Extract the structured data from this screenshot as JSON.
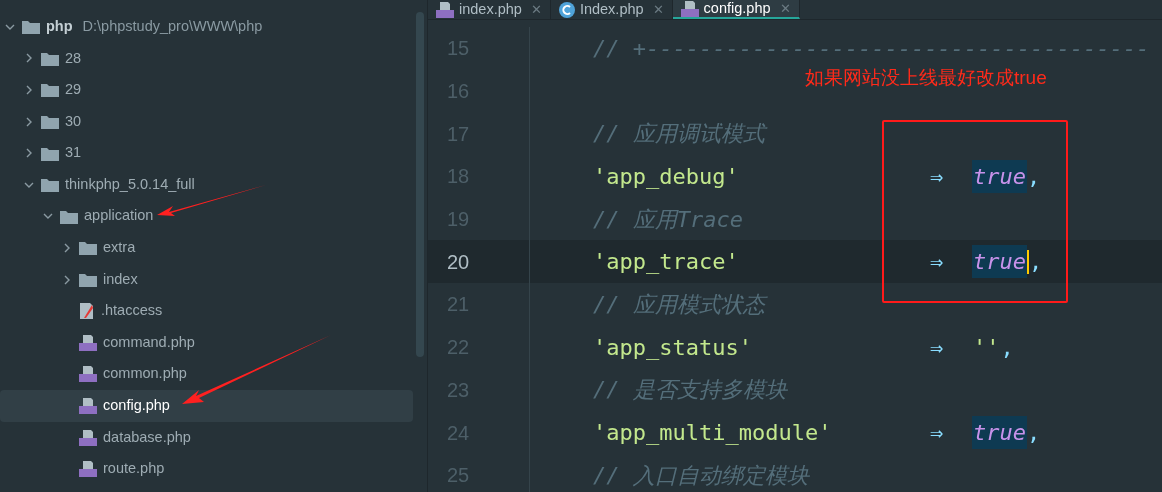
{
  "tabs": [
    {
      "label": "index.php",
      "kind": "php",
      "close": "✕",
      "selected": false
    },
    {
      "label": "Index.php",
      "kind": "class",
      "close": "✕",
      "selected": false
    },
    {
      "label": "config.php",
      "kind": "php",
      "close": "✕",
      "selected": true
    }
  ],
  "tree": [
    {
      "name": "php",
      "path": "D:\\phpstudy_pro\\WWW\\php",
      "kind": "folder",
      "expanded": true,
      "selected": false,
      "children": [
        {
          "name": "28",
          "kind": "folder",
          "expanded": false,
          "selected": false
        },
        {
          "name": "29",
          "kind": "folder",
          "expanded": false,
          "selected": false
        },
        {
          "name": "30",
          "kind": "folder",
          "expanded": false,
          "selected": false
        },
        {
          "name": "31",
          "kind": "folder",
          "expanded": false,
          "selected": false
        },
        {
          "name": "thinkphp_5.0.14_full",
          "kind": "folder",
          "expanded": true,
          "selected": false,
          "children": [
            {
              "name": "application",
              "kind": "folder",
              "expanded": true,
              "selected": false,
              "children": [
                {
                  "name": "extra",
                  "kind": "folder",
                  "expanded": false,
                  "selected": false
                },
                {
                  "name": "index",
                  "kind": "folder",
                  "expanded": false,
                  "selected": false
                },
                {
                  "name": ".htaccess",
                  "kind": "htaccess",
                  "selected": false
                },
                {
                  "name": "command.php",
                  "kind": "php",
                  "selected": false
                },
                {
                  "name": "common.php",
                  "kind": "php",
                  "selected": false
                },
                {
                  "name": "config.php",
                  "kind": "php",
                  "selected": true
                },
                {
                  "name": "database.php",
                  "kind": "php",
                  "selected": false
                },
                {
                  "name": "route.php",
                  "kind": "php",
                  "selected": false
                }
              ]
            }
          ]
        }
      ]
    }
  ],
  "lines": [
    {
      "number": "15",
      "kind": "comment",
      "text": "// +--------------------------------------",
      "current": false
    },
    {
      "number": "16",
      "kind": "blank",
      "current": false
    },
    {
      "number": "17",
      "kind": "comment",
      "text": "// 应用调试模式",
      "current": false
    },
    {
      "number": "18",
      "kind": "entry",
      "key": "'app_debug'",
      "arrow": "⇒",
      "value": {
        "text": "true",
        "kind": "keyword"
      },
      "highlighted": true,
      "tail": ",",
      "current": false
    },
    {
      "number": "19",
      "kind": "comment",
      "text": "// 应用Trace",
      "current": false
    },
    {
      "number": "20",
      "kind": "entry",
      "key": "'app_trace'",
      "arrow": "⇒",
      "value": {
        "text": "true",
        "kind": "keyword"
      },
      "highlighted": true,
      "tail": ",",
      "current": true
    },
    {
      "number": "21",
      "kind": "comment",
      "text": "// 应用模式状态",
      "current": false
    },
    {
      "number": "22",
      "kind": "entry",
      "key": "'app_status'",
      "arrow": "⇒",
      "value": {
        "text": "''",
        "kind": "string"
      },
      "highlighted": false,
      "tail": ",",
      "current": false
    },
    {
      "number": "23",
      "kind": "comment",
      "text": "// 是否支持多模块",
      "current": false
    },
    {
      "number": "24",
      "kind": "entry",
      "key": "'app_multi_module'",
      "arrow": "⇒",
      "value": {
        "text": "true",
        "kind": "keyword"
      },
      "highlighted": true,
      "tail": ",",
      "current": false
    },
    {
      "number": "25",
      "kind": "comment",
      "text": "// 入口自动绑定模块",
      "current": false
    }
  ],
  "annotation": {
    "note": "如果网站没上线最好改成true"
  }
}
